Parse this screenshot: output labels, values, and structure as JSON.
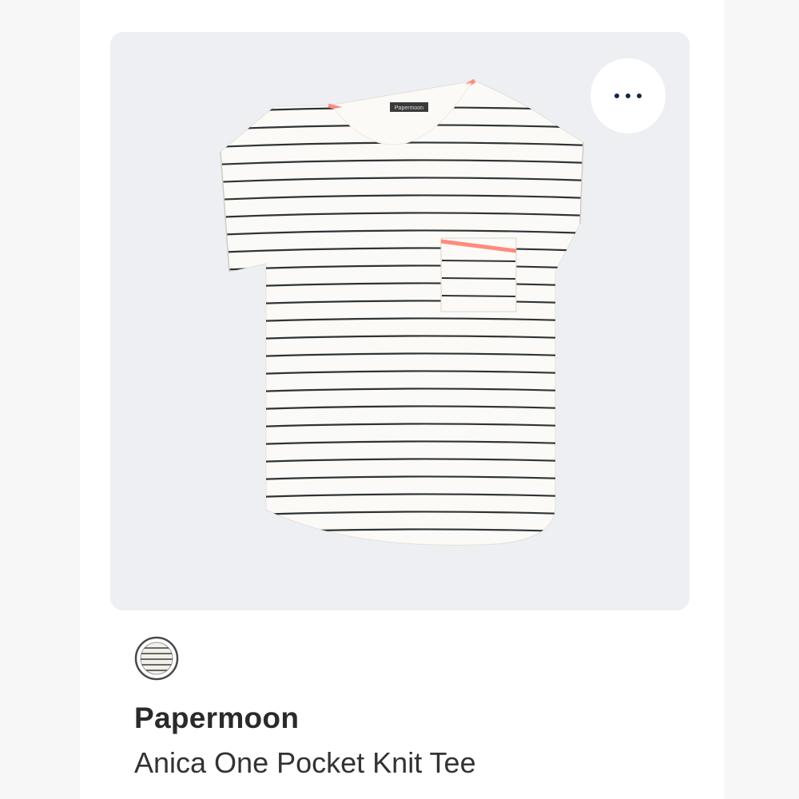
{
  "product": {
    "image_alt": "Striped knit tee with pink trim",
    "brand": "Papermoon",
    "name": "Anica One Pocket Knit Tee",
    "label_text": "Papermoon"
  },
  "actions": {
    "more_icon": "more-horizontal-icon"
  },
  "swatch": {
    "pattern": "stripe",
    "selected": true
  },
  "colors": {
    "card_bg": "#eeeff2",
    "stripe": "#2e3335",
    "fabric": "#fbfaf6",
    "trim": "#ff8a7e",
    "more_dots": "#12284a"
  }
}
